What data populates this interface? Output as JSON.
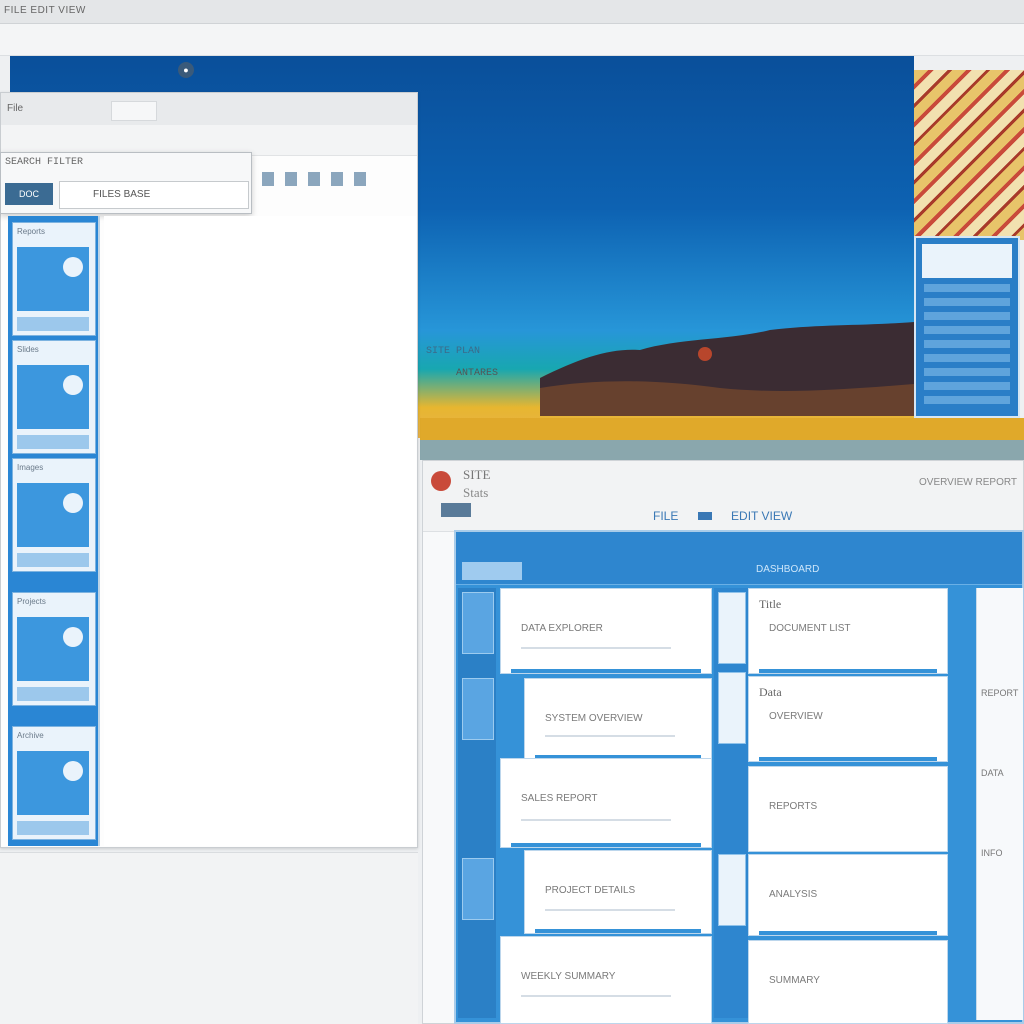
{
  "topbar": {
    "title": "FILE EDIT VIEW"
  },
  "wallpaper": {
    "caption": "ANTARES",
    "caption2": "SITE PLAN"
  },
  "left_window": {
    "title": "File",
    "popup": {
      "row1": "SEARCH FILTER",
      "row2": "FILES BASE",
      "icon_text": "DOC"
    },
    "thumbnails": [
      {
        "label": "Reports"
      },
      {
        "label": "Slides"
      },
      {
        "label": "Images"
      },
      {
        "label": "Projects"
      },
      {
        "label": "Archive"
      }
    ]
  },
  "right_window": {
    "title": "SITE",
    "subtitle": "Stats",
    "right_text": "OVERVIEW REPORT",
    "tabs": [
      "FILE",
      "EDIT VIEW"
    ],
    "app_bar_text": "DASHBOARD",
    "cards": [
      {
        "header": "",
        "text": "DATA EXPLORER"
      },
      {
        "header": "",
        "text": "SYSTEM OVERVIEW"
      },
      {
        "header": "",
        "text": "SALES REPORT"
      },
      {
        "header": "",
        "text": "PROJECT DETAILS"
      },
      {
        "header": "",
        "text": "WEEKLY SUMMARY"
      }
    ],
    "panels": [
      {
        "header": "Title",
        "text": "DOCUMENT LIST"
      },
      {
        "header": "Data",
        "text": "OVERVIEW"
      },
      {
        "header": "",
        "text": "REPORTS"
      },
      {
        "header": "",
        "text": "ANALYSIS"
      },
      {
        "header": "",
        "text": "SUMMARY"
      }
    ],
    "far_labels": [
      "REPORT",
      "DATA",
      "INFO"
    ]
  },
  "colors": {
    "accent": "#3592d8",
    "sky": "#0d62b2",
    "sand": "#e7b630"
  }
}
